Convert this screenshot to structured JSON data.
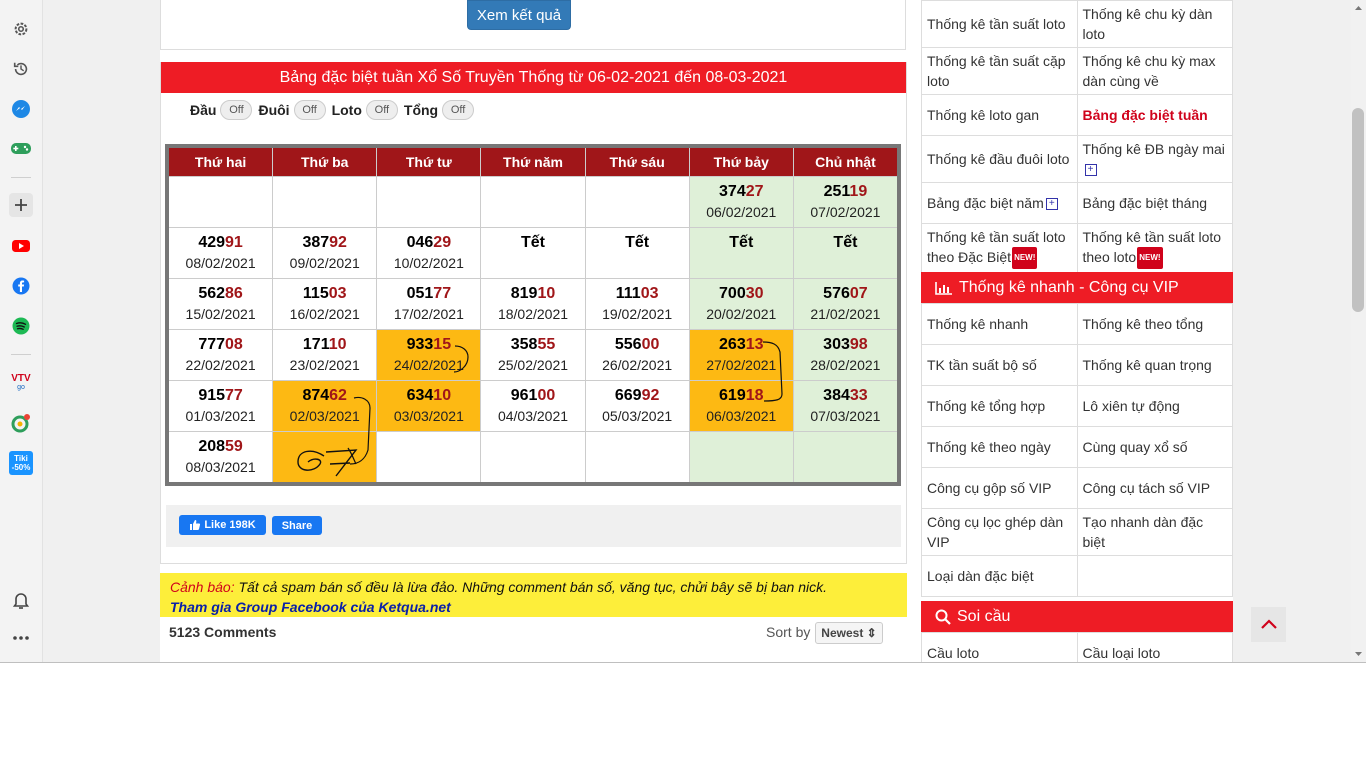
{
  "sidebar": {
    "icons": [
      "gear-icon",
      "history-icon",
      "messenger-icon",
      "game-icon",
      "plus-icon",
      "youtube-icon",
      "facebook-icon",
      "spotify-icon",
      "vtv-icon",
      "color-circle-icon",
      "tiki-icon",
      "bell-icon",
      "more-icon"
    ],
    "vtv_label": "VTV",
    "vtv_sub": "go",
    "tiki_label": "Tiki",
    "tiki_sub": "-50%"
  },
  "top": {
    "result_button": "Xem kết quả"
  },
  "main": {
    "title": "Bảng đặc biệt tuần Xổ Số Truyền Thống từ 06-02-2021 đến 08-03-2021",
    "toggles": [
      {
        "label": "Đầu",
        "state": "Off"
      },
      {
        "label": "Đuôi",
        "state": "Off"
      },
      {
        "label": "Loto",
        "state": "Off"
      },
      {
        "label": "Tổng",
        "state": "Off"
      }
    ],
    "days": [
      "Thứ hai",
      "Thứ ba",
      "Thứ tư",
      "Thứ năm",
      "Thứ sáu",
      "Thứ bảy",
      "Chủ nhật"
    ],
    "rows": [
      [
        {},
        {},
        {},
        {},
        {},
        {
          "head": "374",
          "tail": "27",
          "date": "06/02/2021"
        },
        {
          "head": "251",
          "tail": "19",
          "date": "07/02/2021"
        }
      ],
      [
        {
          "head": "429",
          "tail": "91",
          "date": "08/02/2021"
        },
        {
          "head": "387",
          "tail": "92",
          "date": "09/02/2021"
        },
        {
          "head": "046",
          "tail": "29",
          "date": "10/02/2021"
        },
        {
          "text": "Tết"
        },
        {
          "text": "Tết"
        },
        {
          "text": "Tết"
        },
        {
          "text": "Tết"
        }
      ],
      [
        {
          "head": "562",
          "tail": "86",
          "date": "15/02/2021"
        },
        {
          "head": "115",
          "tail": "03",
          "date": "16/02/2021"
        },
        {
          "head": "051",
          "tail": "77",
          "date": "17/02/2021"
        },
        {
          "head": "819",
          "tail": "10",
          "date": "18/02/2021"
        },
        {
          "head": "111",
          "tail": "03",
          "date": "19/02/2021"
        },
        {
          "head": "700",
          "tail": "30",
          "date": "20/02/2021"
        },
        {
          "head": "576",
          "tail": "07",
          "date": "21/02/2021"
        }
      ],
      [
        {
          "head": "777",
          "tail": "08",
          "date": "22/02/2021"
        },
        {
          "head": "171",
          "tail": "10",
          "date": "23/02/2021"
        },
        {
          "head": "933",
          "tail": "15",
          "date": "24/02/2021",
          "hl": true
        },
        {
          "head": "358",
          "tail": "55",
          "date": "25/02/2021"
        },
        {
          "head": "556",
          "tail": "00",
          "date": "26/02/2021"
        },
        {
          "head": "263",
          "tail": "13",
          "date": "27/02/2021",
          "hl": true
        },
        {
          "head": "303",
          "tail": "98",
          "date": "28/02/2021"
        }
      ],
      [
        {
          "head": "915",
          "tail": "77",
          "date": "01/03/2021"
        },
        {
          "head": "874",
          "tail": "62",
          "date": "02/03/2021",
          "hl": true
        },
        {
          "head": "634",
          "tail": "10",
          "date": "03/03/2021",
          "hl": true
        },
        {
          "head": "961",
          "tail": "00",
          "date": "04/03/2021"
        },
        {
          "head": "669",
          "tail": "92",
          "date": "05/03/2021"
        },
        {
          "head": "619",
          "tail": "18",
          "date": "06/03/2021",
          "hl": true
        },
        {
          "head": "384",
          "tail": "33",
          "date": "07/03/2021"
        }
      ],
      [
        {
          "head": "208",
          "tail": "59",
          "date": "08/03/2021"
        },
        {
          "hl": true,
          "handwriting": "67"
        },
        {},
        {},
        {},
        {},
        {}
      ]
    ],
    "fb_like": "Like 198K",
    "fb_share": "Share",
    "warning_label": "Cảnh báo:",
    "warning_text": " Tất cả spam bán số đều là lừa đảo. Những comment bán số, văng tục, chửi bây sẽ bị ban nick.",
    "group_link": "Tham gia Group Facebook của Ketqua.net",
    "comments_count": "5123 Comments",
    "sort_label": "Sort by",
    "sort_value": "Newest ⇕"
  },
  "right": {
    "stats": [
      [
        "Thống kê tần suất loto",
        "Thống kê chu kỳ dàn loto"
      ],
      [
        "Thống kê tần suất cặp loto",
        "Thống kê chu kỳ max dàn cùng về"
      ],
      [
        "Thống kê loto gan",
        "Bảng đặc biệt tuần"
      ],
      [
        "Thống kê đầu đuôi loto",
        "Thống kê ĐB ngày mai"
      ],
      [
        "Bảng đặc biệt năm",
        "Bảng đặc biệt tháng"
      ],
      [
        "Thống kê tần suất loto theo Đặc Biệt",
        "Thống kê tần suất loto theo loto"
      ]
    ],
    "new_badge": "NEW!",
    "quick_header": "Thống kê nhanh - Công cụ VIP",
    "quick": [
      [
        "Thống kê nhanh",
        "Thống kê theo tổng"
      ],
      [
        "TK tần suất bộ số",
        "Thống kê quan trọng"
      ],
      [
        "Thống kê tổng hợp",
        "Lô xiên tự động"
      ],
      [
        "Thống kê theo ngày",
        "Cùng quay xổ số"
      ],
      [
        "Công cụ gộp số VIP",
        "Công cụ tách số VIP"
      ],
      [
        "Công cụ lọc ghép dàn VIP",
        "Tạo nhanh dàn đặc biệt"
      ],
      [
        "Loại dàn đặc biệt",
        ""
      ]
    ],
    "soi_header": "Soi cầu",
    "soi": [
      [
        "Cầu loto",
        "Cầu loại loto"
      ]
    ]
  },
  "colors": {
    "red": "#ee1c25",
    "dark_red": "#a01619",
    "highlight": "#fdb913",
    "weekend": "#dff0d8",
    "link_blue": "#0a20a8",
    "warn_yellow": "#fdee3a"
  }
}
